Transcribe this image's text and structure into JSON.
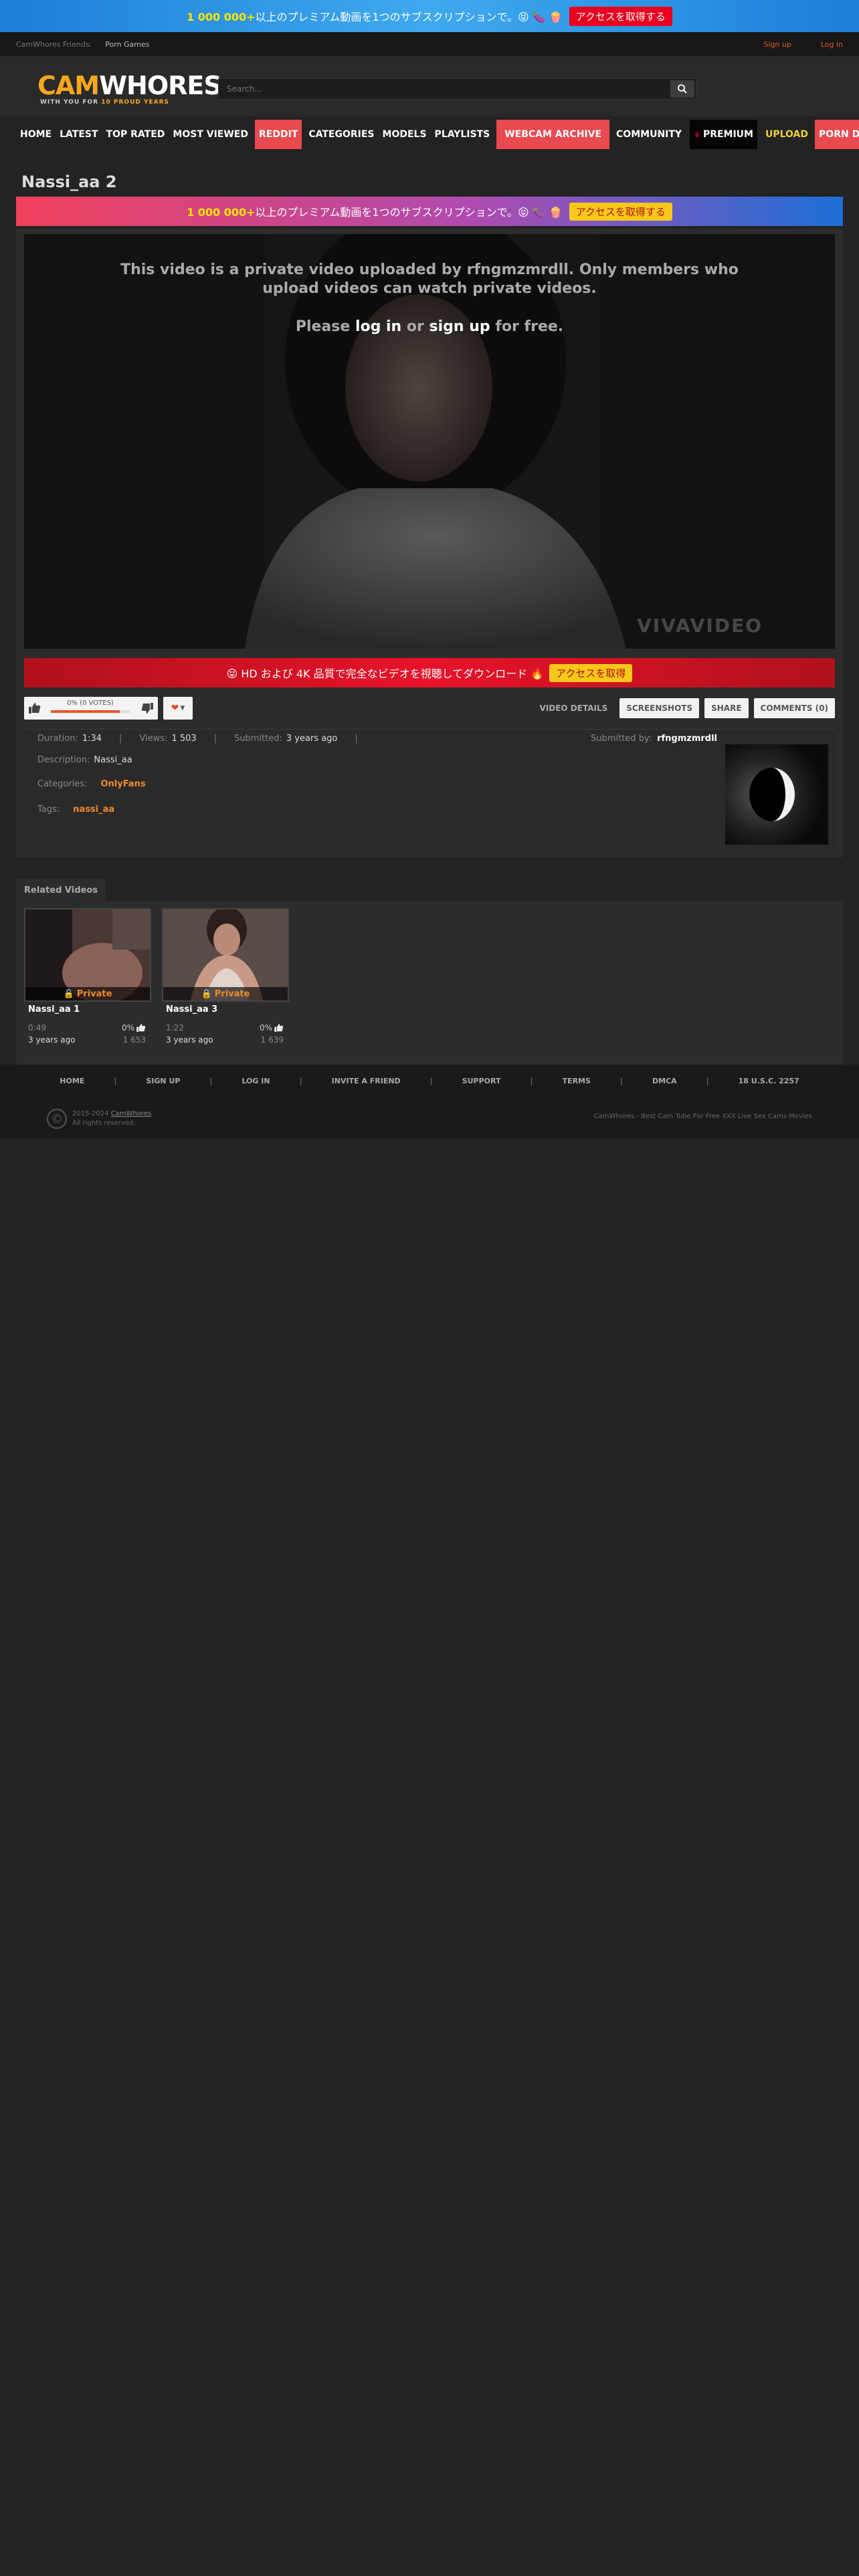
{
  "promo_top": {
    "highlight": "1 000 000+",
    "text": "以上のプレミアム動画を1つのサブスクリプションで。😝 🍆 🍿",
    "button": "アクセスを取得する"
  },
  "friends_bar": {
    "label": "CamWhores Friends:",
    "link": "Porn Games",
    "signup": "Sign up",
    "login": "Log in"
  },
  "logo": {
    "cam": "CAM",
    "whores": "WHORES",
    "tagline_pre": "WITH YOU FOR",
    "tagline_hl": "10 PROUD YEARS"
  },
  "search": {
    "placeholder": "Search...",
    "icon": "search-icon"
  },
  "nav": [
    "HOME",
    "LATEST",
    "TOP RATED",
    "MOST VIEWED",
    "REDDIT",
    "CATEGORIES",
    "MODELS",
    "PLAYLISTS",
    "WEBCAM ARCHIVE",
    "COMMUNITY",
    "PREMIUM",
    "UPLOAD",
    "PORN DUDE"
  ],
  "page_title": "Nassi_aa 2",
  "promo_mid": {
    "highlight": "1 000 000+",
    "text": "以上のプレミアム動画を1つのサブスクリプションで。😝 🍆 🍿",
    "button": "アクセスを取得する"
  },
  "player": {
    "private_msg": "This video is a private video uploaded by rfngmzmrdll. Only members who upload videos can watch private videos.",
    "please": "Please",
    "log_in": "log in",
    "or": "or",
    "sign_up": "sign up",
    "for_free": "for free.",
    "watermark": "VIVAVIDEO"
  },
  "promo_hd": {
    "text": "😝 HD および 4K 品質で完全なビデオを視聴してダウンロード 🔥",
    "button": "アクセスを取得"
  },
  "rating": {
    "label": "0% (0 VOTES)",
    "percent": 0.87
  },
  "tabs": [
    "VIDEO DETAILS",
    "SCREENSHOTS",
    "SHARE",
    "COMMENTS (0)"
  ],
  "info": {
    "duration_label": "Duration:",
    "duration": "1:34",
    "views_label": "Views:",
    "views": "1 503",
    "submitted_label": "Submitted:",
    "submitted": "3 years ago",
    "description_label": "Description:",
    "description": "Nassi_aa",
    "categories_label": "Categories:",
    "category": "OnlyFans",
    "tags_label": "Tags:",
    "tag": "nassi_aa",
    "submitted_by_label": "Submitted by:",
    "submitted_by": "rfngmzmrdll"
  },
  "related": {
    "tab": "Related Videos",
    "items": [
      {
        "title": "Nassi_aa 1",
        "badge": "Private",
        "duration": "0:49",
        "rating": "0%",
        "ago": "3 years ago",
        "views": "1 653"
      },
      {
        "title": "Nassi_aa 3",
        "badge": "Private",
        "duration": "1:22",
        "rating": "0%",
        "ago": "3 years ago",
        "views": "1 639"
      }
    ]
  },
  "footer": {
    "links": [
      "HOME",
      "SIGN UP",
      "LOG IN",
      "INVITE A FRIEND",
      "SUPPORT",
      "TERMS",
      "DMCA",
      "18 U.S.C. 2257"
    ],
    "copyright_years": "2015-2024",
    "copyright_brand": "CamWhores",
    "rights": "All rights reserved.",
    "tagline": "CamWhores - Best Cam Tube For Free XXX Live Sex Cams Movies"
  }
}
